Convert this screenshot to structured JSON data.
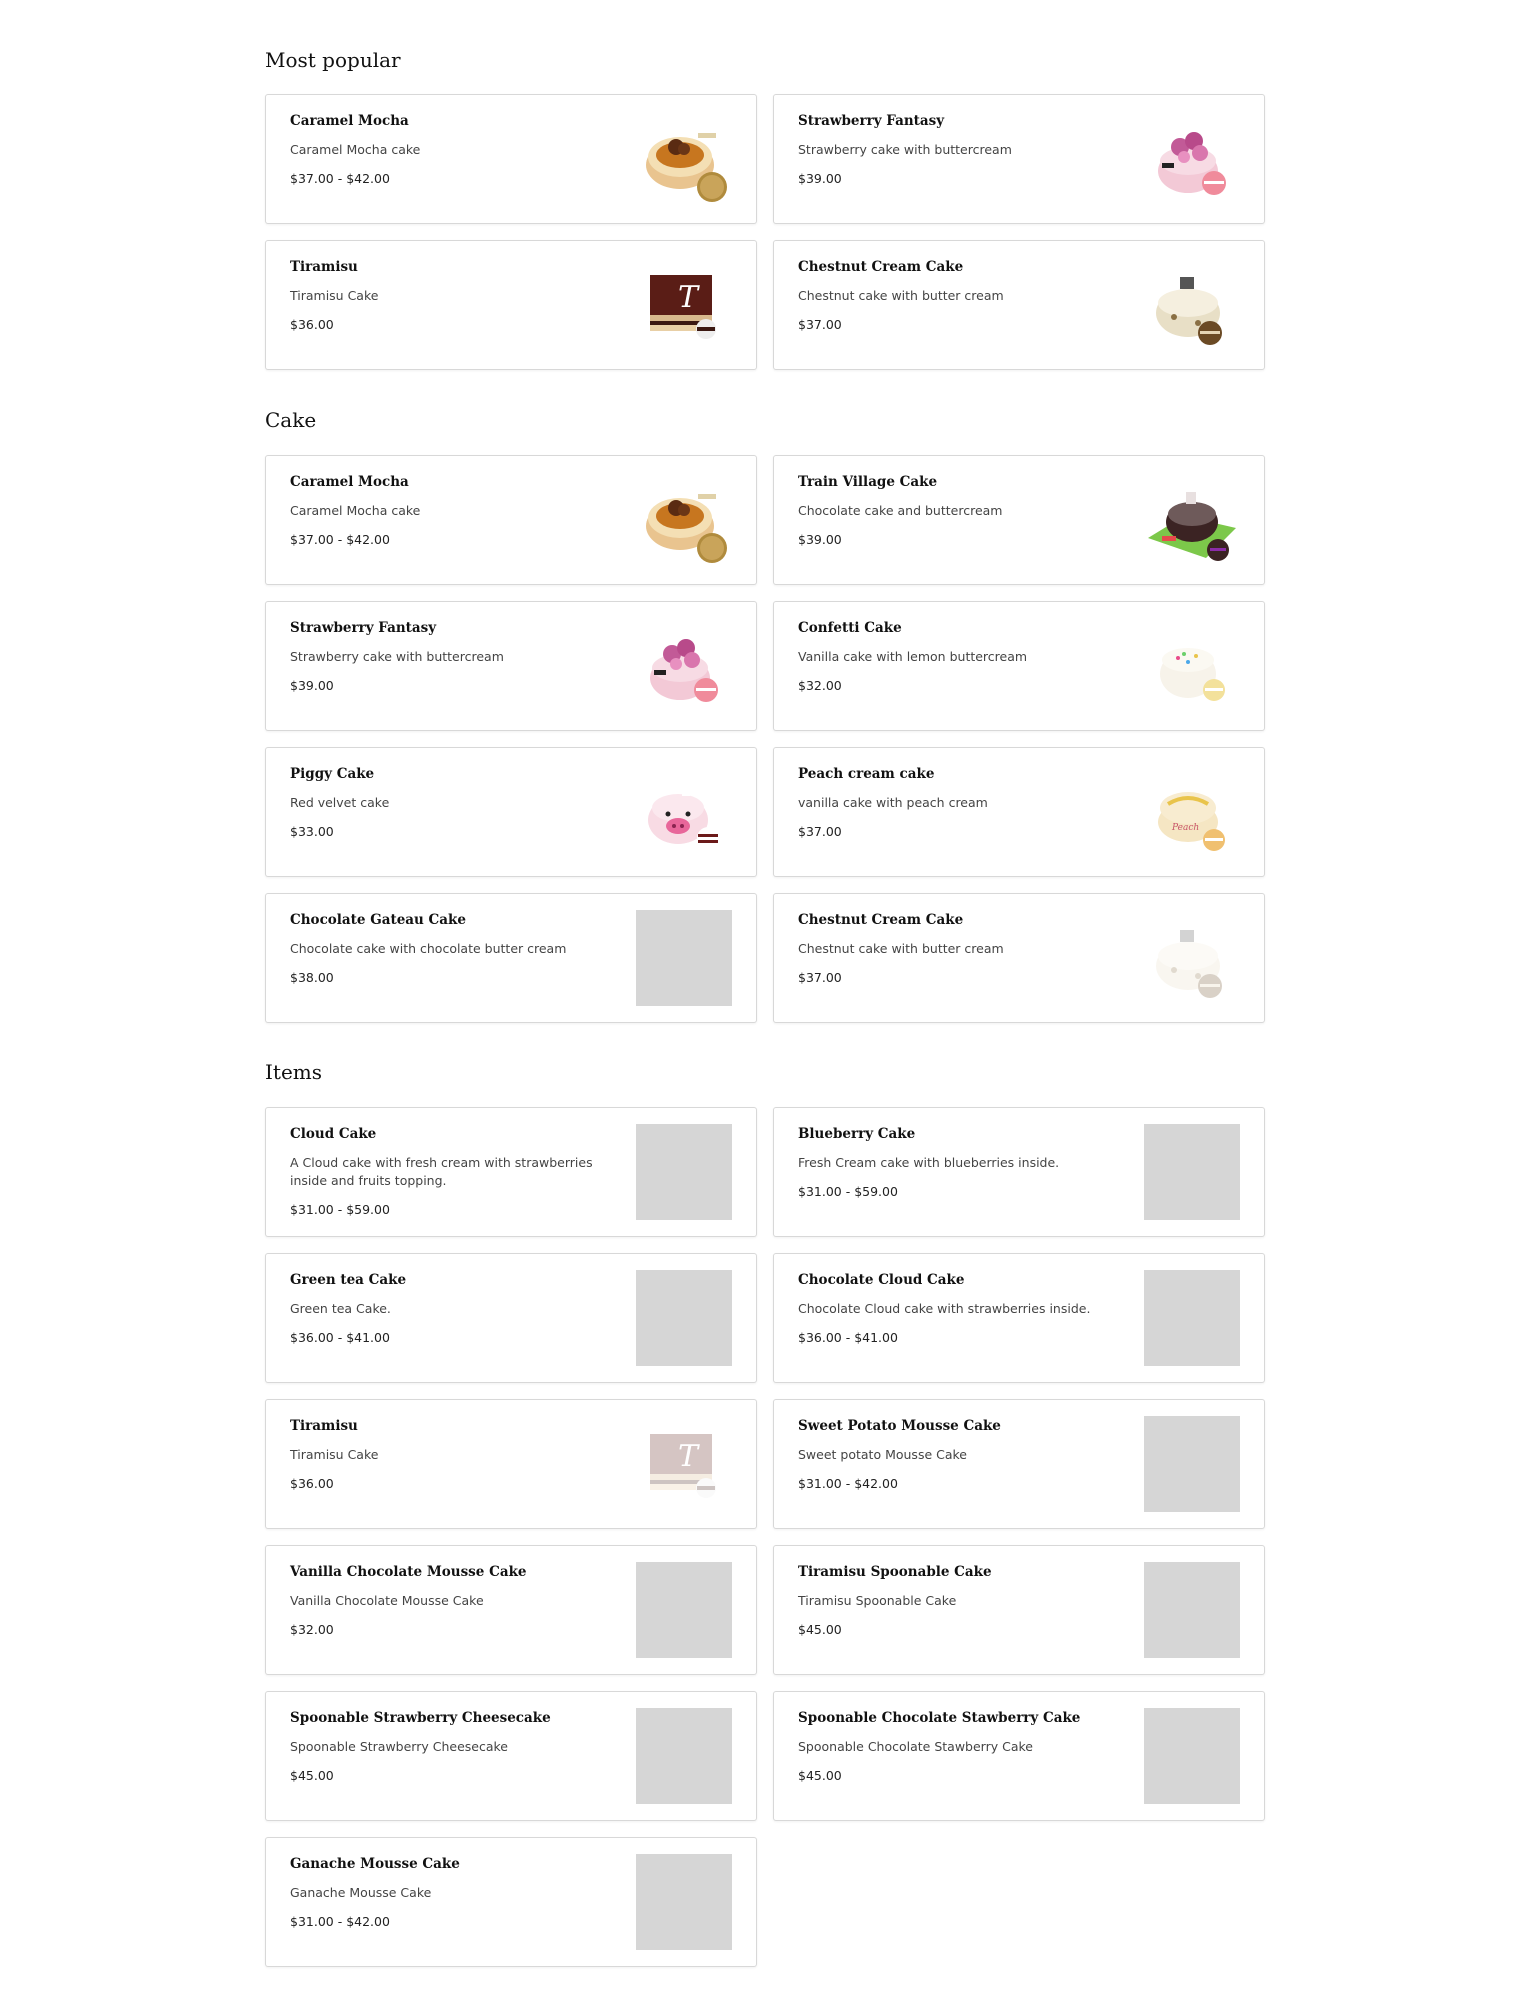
{
  "sections": [
    {
      "title": "Most popular",
      "items": [
        {
          "name": "Caramel Mocha",
          "desc": "Caramel Mocha cake",
          "price": "$37.00 - $42.00",
          "image": "caramel-mocha"
        },
        {
          "name": "Strawberry Fantasy",
          "desc": "Strawberry cake with buttercream",
          "price": "$39.00",
          "image": "strawberry-fantasy"
        },
        {
          "name": "Tiramisu",
          "desc": "Tiramisu Cake",
          "price": "$36.00",
          "image": "tiramisu"
        },
        {
          "name": "Chestnut Cream Cake",
          "desc": "Chestnut cake with butter cream",
          "price": "$37.00",
          "image": "chestnut"
        }
      ]
    },
    {
      "title": "Cake",
      "items": [
        {
          "name": "Caramel Mocha",
          "desc": "Caramel Mocha cake",
          "price": "$37.00 - $42.00",
          "image": "caramel-mocha"
        },
        {
          "name": "Train Village Cake",
          "desc": "Chocolate cake and buttercream",
          "price": "$39.00",
          "image": "train-village"
        },
        {
          "name": "Strawberry Fantasy",
          "desc": "Strawberry cake with buttercream",
          "price": "$39.00",
          "image": "strawberry-fantasy"
        },
        {
          "name": "Confetti Cake",
          "desc": "Vanilla cake with lemon buttercream",
          "price": "$32.00",
          "image": "confetti"
        },
        {
          "name": "Piggy Cake",
          "desc": "Red velvet cake",
          "price": "$33.00",
          "image": "piggy"
        },
        {
          "name": "Peach cream cake",
          "desc": "vanilla cake with peach cream",
          "price": "$37.00",
          "image": "peach"
        },
        {
          "name": "Chocolate Gateau Cake",
          "desc": "Chocolate cake with chocolate butter cream",
          "price": "$38.00",
          "image": "placeholder"
        },
        {
          "name": "Chestnut Cream Cake",
          "desc": "Chestnut cake with butter cream",
          "price": "$37.00",
          "image": "chestnut-faded"
        }
      ]
    },
    {
      "title": "Items",
      "items": [
        {
          "name": "Cloud Cake",
          "desc": "A Cloud cake with fresh cream with strawberries inside and fruits topping.",
          "price": "$31.00 - $59.00",
          "image": "placeholder"
        },
        {
          "name": "Blueberry Cake",
          "desc": "Fresh Cream cake with blueberries inside.",
          "price": "$31.00 - $59.00",
          "image": "placeholder"
        },
        {
          "name": "Green tea Cake",
          "desc": "Green tea Cake.",
          "price": "$36.00 - $41.00",
          "image": "placeholder"
        },
        {
          "name": "Chocolate Cloud Cake",
          "desc": "Chocolate Cloud cake with strawberries inside.",
          "price": "$36.00 - $41.00",
          "image": "placeholder"
        },
        {
          "name": "Tiramisu",
          "desc": "Tiramisu Cake",
          "price": "$36.00",
          "image": "tiramisu-faded"
        },
        {
          "name": "Sweet Potato Mousse Cake",
          "desc": "Sweet potato Mousse Cake",
          "price": "$31.00 - $42.00",
          "image": "placeholder"
        },
        {
          "name": "Vanilla Chocolate Mousse Cake",
          "desc": "Vanilla Chocolate Mousse Cake",
          "price": "$32.00",
          "image": "placeholder"
        },
        {
          "name": "Tiramisu Spoonable Cake",
          "desc": "Tiramisu Spoonable Cake",
          "price": "$45.00",
          "image": "placeholder"
        },
        {
          "name": "Spoonable Strawberry Cheesecake",
          "desc": "Spoonable Strawberry Cheesecake",
          "price": "$45.00",
          "image": "placeholder"
        },
        {
          "name": "Spoonable Chocolate Stawberry Cake",
          "desc": "Spoonable Chocolate Stawberry Cake",
          "price": "$45.00",
          "image": "placeholder"
        },
        {
          "name": "Ganache Mousse Cake",
          "desc": "Ganache Mousse Cake",
          "price": "$31.00 - $42.00",
          "image": "placeholder"
        }
      ]
    }
  ]
}
